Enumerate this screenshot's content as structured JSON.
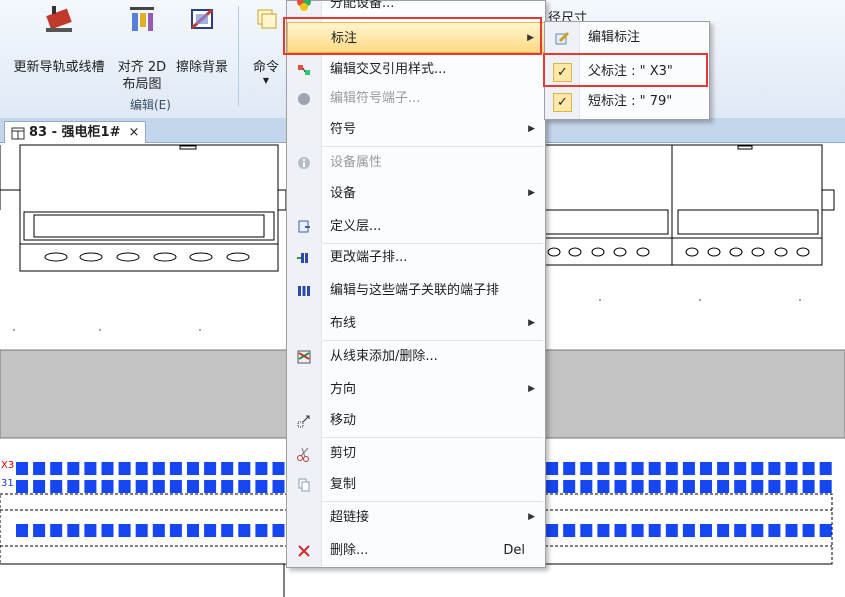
{
  "ribbon": {
    "buttons": [
      {
        "label": "更新导轨或线槽",
        "icon": "rail-update-icon"
      },
      {
        "label": "对齐 2D 布局图",
        "icon": "align-2d-layout-icon"
      },
      {
        "label": "擦除背景",
        "icon": "erase-background-icon"
      },
      {
        "label": "命令",
        "icon": "command-icon"
      }
    ],
    "group_label": "编辑(E)",
    "partial_label": "径尺寸"
  },
  "document_tab": {
    "label": "83 - 强电柜1#",
    "close": "×"
  },
  "context_menu": {
    "items": [
      {
        "label": "分配设备...",
        "icon": "assign-device-icon",
        "disabled": false,
        "submenu": false
      },
      {
        "label": "标注",
        "icon": "",
        "disabled": false,
        "submenu": true,
        "highlighted": true
      },
      {
        "label": "编辑交叉引用样式...",
        "icon": "cross-reference-icon",
        "disabled": false,
        "submenu": false
      },
      {
        "label": "编辑符号端子...",
        "icon": "symbol-terminal-icon",
        "disabled": true,
        "submenu": false
      },
      {
        "label": "符号",
        "icon": "",
        "disabled": false,
        "submenu": true
      },
      {
        "label": "设备属性",
        "icon": "info-icon",
        "disabled": true,
        "submenu": false
      },
      {
        "label": "设备",
        "icon": "",
        "disabled": false,
        "submenu": true
      },
      {
        "label": "定义层...",
        "icon": "define-layer-icon",
        "disabled": false,
        "submenu": false
      },
      {
        "label": "更改端子排...",
        "icon": "change-terminal-strip-icon",
        "disabled": false,
        "submenu": false
      },
      {
        "label": "编辑与这些端子关联的端子排",
        "icon": "terminal-strip-icon",
        "disabled": false,
        "submenu": false
      },
      {
        "label": "布线",
        "icon": "",
        "disabled": false,
        "submenu": true
      },
      {
        "label": "从线束添加/删除...",
        "icon": "harness-icon",
        "disabled": false,
        "submenu": false
      },
      {
        "label": "方向",
        "icon": "",
        "disabled": false,
        "submenu": true
      },
      {
        "label": "移动",
        "icon": "move-icon",
        "disabled": false,
        "submenu": false
      },
      {
        "label": "剪切",
        "icon": "scissors-icon",
        "disabled": false,
        "submenu": false
      },
      {
        "label": "复制",
        "icon": "copy-icon",
        "disabled": false,
        "submenu": false
      },
      {
        "label": "超链接",
        "icon": "",
        "disabled": false,
        "submenu": true
      },
      {
        "label": "删除...",
        "icon": "delete-icon",
        "disabled": false,
        "submenu": false,
        "shortcut": "Del"
      }
    ]
  },
  "submenu": {
    "items": [
      {
        "label": "编辑标注",
        "icon": "edit-annotation-icon",
        "checked": false
      },
      {
        "label": "父标注 : \" X3\"",
        "checked": true
      },
      {
        "label": "短标注 : \" 79\"",
        "checked": true
      }
    ]
  },
  "canvas": {
    "terminal_labels": [
      "X3",
      "31"
    ]
  },
  "colors": {
    "highlight_border": "#e53935",
    "terminal_blue": "#1646f0",
    "ribbon_bg": "#dfe9f5"
  }
}
